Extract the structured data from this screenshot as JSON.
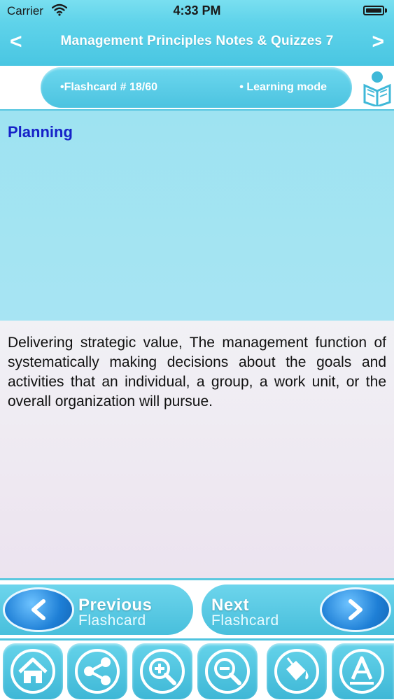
{
  "status_bar": {
    "carrier": "Carrier",
    "time": "4:33 PM"
  },
  "nav": {
    "back_label": "<",
    "title": "Management Principles Notes & Quizzes 7",
    "forward_label": ">"
  },
  "info": {
    "card_label": "•Flashcard #  18/60",
    "mode_label": "• Learning mode"
  },
  "card": {
    "term": "Planning",
    "definition": "Delivering strategic value, The management function of systematically making decisions about the goals and activities that an individual, a group, a work unit, or the overall organization will pursue."
  },
  "card_nav": {
    "previous": {
      "line1": "Previous",
      "line2": "Flashcard"
    },
    "next": {
      "line1": "Next",
      "line2": "Flashcard"
    }
  },
  "toolbar": {
    "items": [
      "home-icon",
      "share-icon",
      "zoom-in-icon",
      "zoom-out-icon",
      "paint-bucket-icon",
      "font-icon"
    ]
  },
  "colors": {
    "accent": "#4cc3e0",
    "term": "#1622c8",
    "button_blue": "#1e7fd6"
  }
}
